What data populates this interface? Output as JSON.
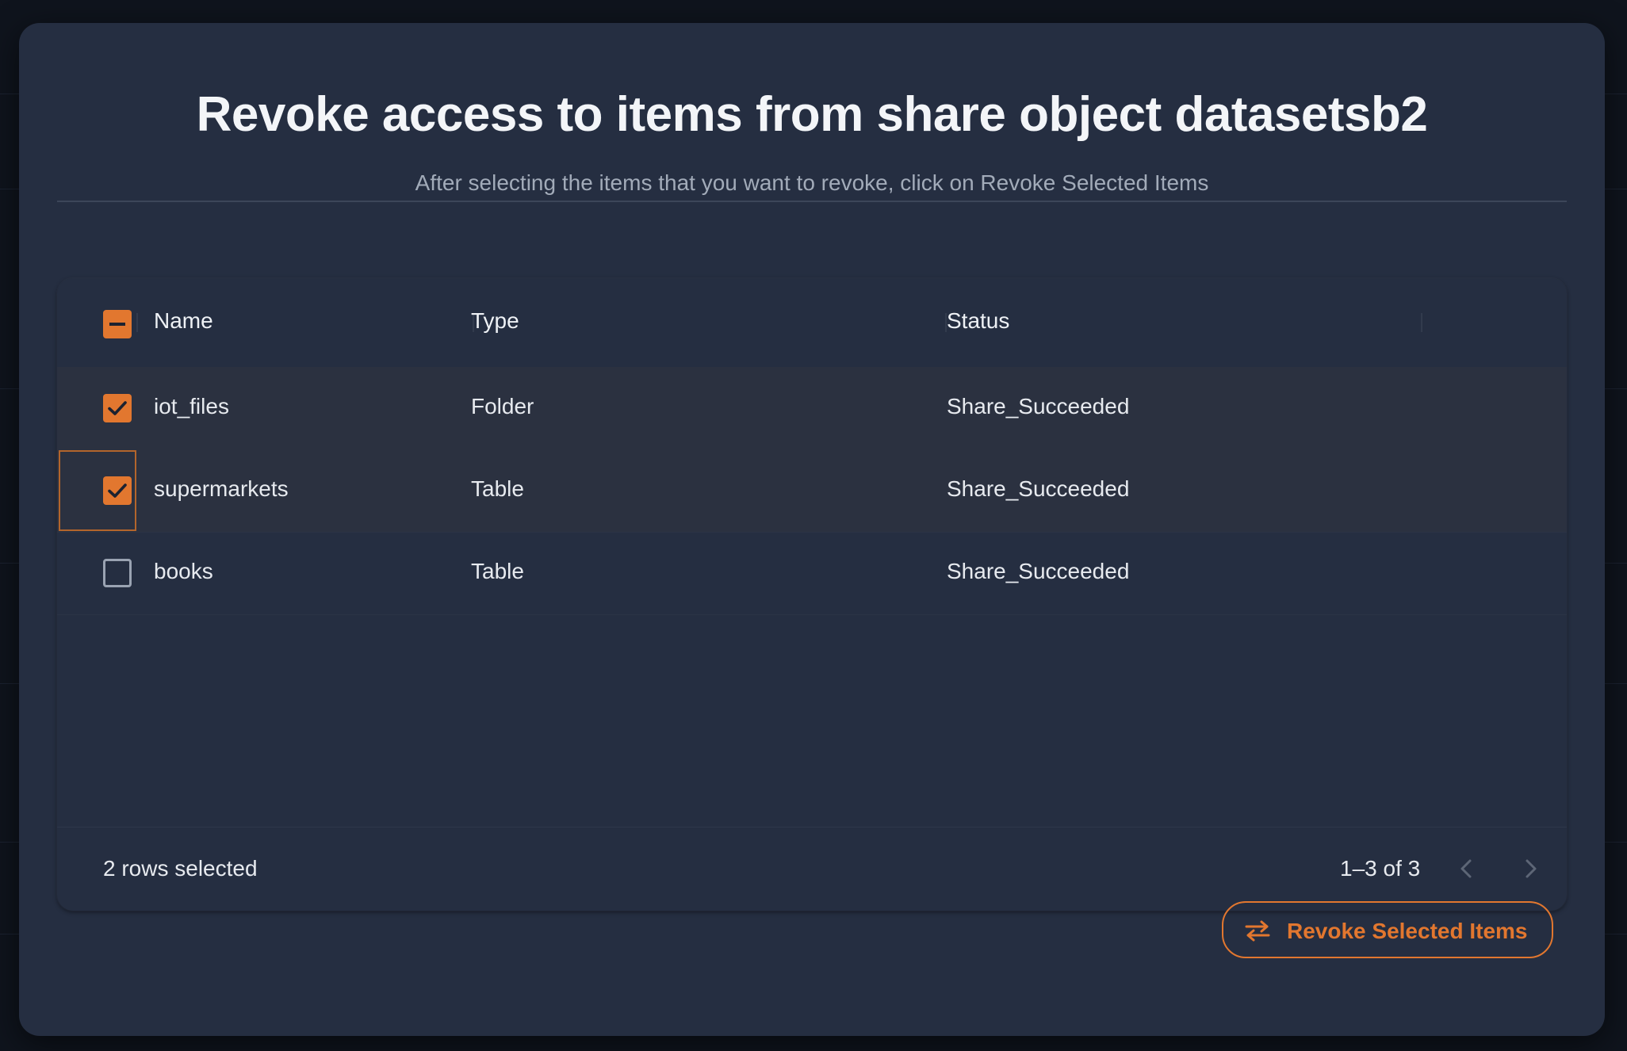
{
  "modal": {
    "title": "Revoke access to items from share object datasetsb2",
    "subtitle": "After selecting the items that you want to revoke, click on Revoke Selected Items"
  },
  "table": {
    "columns": [
      "Name",
      "Type",
      "Status"
    ],
    "select_all_state": "indeterminate",
    "rows": [
      {
        "name": "iot_files",
        "type": "Folder",
        "status": "Share_Succeeded",
        "selected": true
      },
      {
        "name": "supermarkets",
        "type": "Table",
        "status": "Share_Succeeded",
        "selected": true
      },
      {
        "name": "books",
        "type": "Table",
        "status": "Share_Succeeded",
        "selected": false
      }
    ],
    "footer": {
      "selection_text": "2 rows selected",
      "pagination_text": "1–3 of 3"
    }
  },
  "actions": {
    "revoke_label": "Revoke Selected Items",
    "revoke_icon": "swap-horiz-icon"
  },
  "colors": {
    "accent": "#e2772f",
    "modal_background": "#252e41",
    "selected_row": "#2b3140"
  }
}
